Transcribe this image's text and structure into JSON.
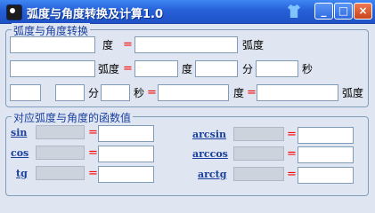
{
  "window": {
    "title": "弧度与角度转换及计算1.0",
    "controls": {
      "minimize": "_",
      "maximize": "□",
      "close": "×"
    }
  },
  "conversion": {
    "group_title": "弧度与角度转换",
    "row1": {
      "degree_label": "度",
      "eq": "=",
      "radian_label": "弧度"
    },
    "row2": {
      "radian_label": "弧度",
      "eq": "=",
      "degree_label": "度",
      "minute_label": "分",
      "second_label": "秒"
    },
    "row3": {
      "minute_label": "分",
      "second_label": "秒",
      "eq": "=",
      "degree_label": "度",
      "eq2": "=",
      "radian_label": "弧度"
    }
  },
  "functions": {
    "group_title": "对应弧度与角度的函数值",
    "left": [
      {
        "label": "sin",
        "eq": "="
      },
      {
        "label": "cos",
        "eq": "="
      },
      {
        "label": "tg",
        "eq": "="
      }
    ],
    "right": [
      {
        "label": "arcsin",
        "eq": "="
      },
      {
        "label": "arccos",
        "eq": "="
      },
      {
        "label": "arctg",
        "eq": "="
      }
    ]
  }
}
